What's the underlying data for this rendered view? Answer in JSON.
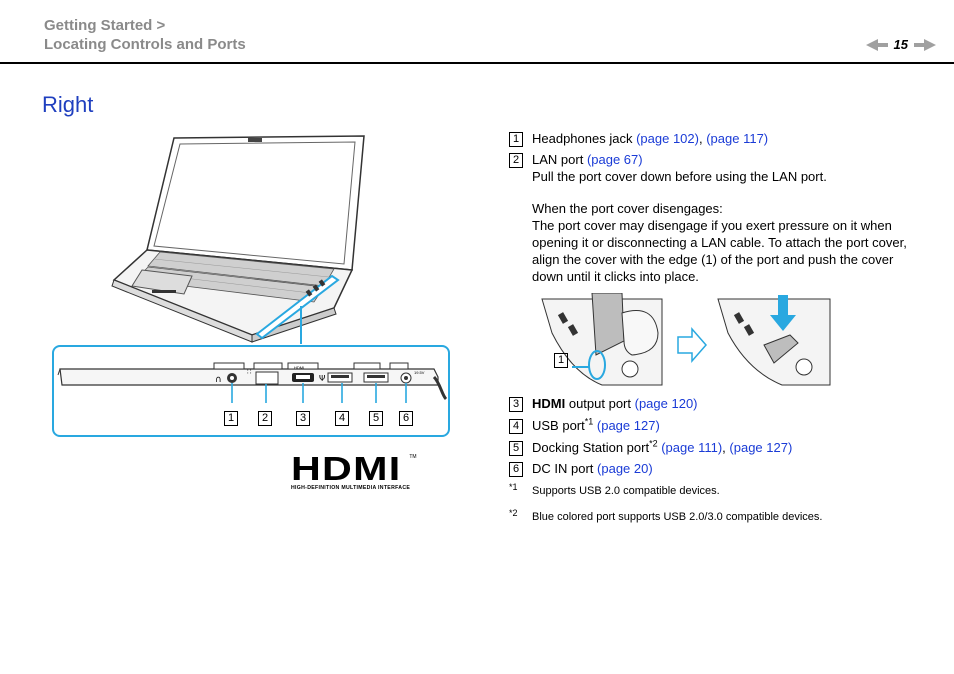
{
  "header": {
    "breadcrumb_line1": "Getting Started >",
    "breadcrumb_line2": "Locating Controls and Ports",
    "page_number": "15",
    "prev_icon": "arrow-left-icon",
    "next_icon": "arrow-right-icon"
  },
  "section": {
    "title": "Right"
  },
  "figure": {
    "callouts": [
      "1",
      "2",
      "3",
      "4",
      "5",
      "6"
    ],
    "port_labels": {
      "hdmi": "HDMI",
      "usb": "USB",
      "dc": "19.5V"
    },
    "logo": {
      "text": "HDMI",
      "trademark": "TM",
      "tagline": "HIGH-DEFINITION MULTIMEDIA INTERFACE"
    },
    "lan_callout": "1"
  },
  "items": [
    {
      "num": "1",
      "label": "Headphones jack",
      "links": [
        "(page 102)",
        "(page 117)"
      ]
    },
    {
      "num": "2",
      "label": "LAN port",
      "links": [
        "(page 67)"
      ],
      "note": "Pull the port cover down before using the LAN port.",
      "subhead": "When the port cover disengages:",
      "para": "The port cover may disengage if you exert pressure on it when opening it or disconnecting a LAN cable. To attach the port cover, align the cover with the edge (1) of the port and push the cover down until it clicks into place."
    },
    {
      "num": "3",
      "label_bold": "HDMI",
      "label": "output port",
      "links": [
        "(page 120)"
      ]
    },
    {
      "num": "4",
      "label": "USB port",
      "sup": "*1",
      "links": [
        "(page 127)"
      ]
    },
    {
      "num": "5",
      "label": "Docking Station port",
      "sup": "*2",
      "links": [
        "(page 111)",
        "(page 127)"
      ]
    },
    {
      "num": "6",
      "label": "DC IN port",
      "links": [
        "(page 20)"
      ]
    }
  ],
  "footnotes": [
    {
      "mark": "*1",
      "text": "Supports USB 2.0 compatible devices."
    },
    {
      "mark": "*2",
      "text": "Blue colored port supports USB 2.0/3.0 compatible devices."
    }
  ]
}
